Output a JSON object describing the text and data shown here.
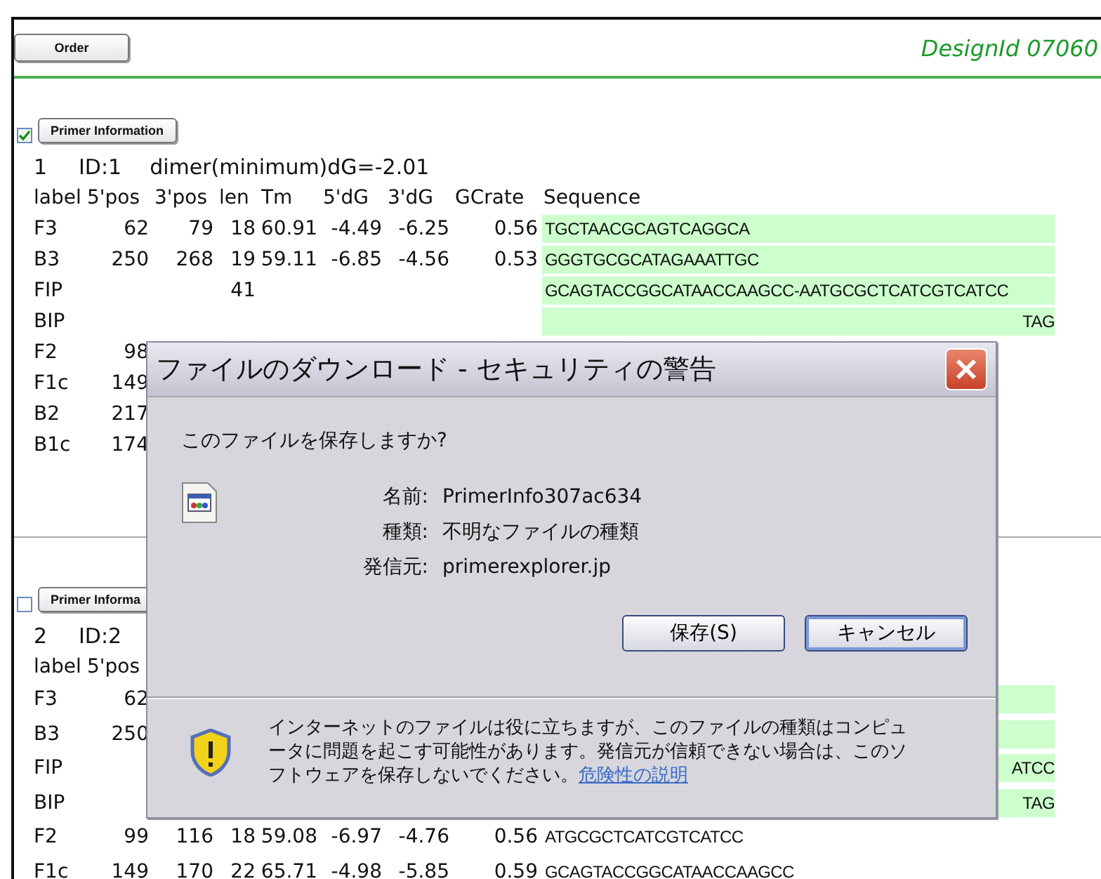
{
  "toolbar": {
    "order_button": "Order",
    "design_id": "DesignId 07060"
  },
  "blocks": [
    {
      "checked": true,
      "button": "Primer Information",
      "number": "1",
      "id": "ID:1",
      "dimer": "dimer(minimum)dG=-2.01",
      "columns": [
        "label",
        "5'pos",
        "3'pos",
        "len",
        "Tm",
        "5'dG",
        "3'dG",
        "GCrate",
        "Sequence"
      ],
      "rows": [
        {
          "label": "F3",
          "pos5": "62",
          "pos3": "79",
          "len": "18",
          "tm": "60.91",
          "dg5": "-4.49",
          "dg3": "-6.25",
          "gc": "0.56",
          "sequence": "TGCTAACGCAGTCAGGCA",
          "highlighted": true
        },
        {
          "label": "B3",
          "pos5": "250",
          "pos3": "268",
          "len": "19",
          "tm": "59.11",
          "dg5": "-6.85",
          "dg3": "-4.56",
          "gc": "0.53",
          "sequence": "GGGTGCGCATAGAAATTGC",
          "highlighted": true
        },
        {
          "label": "FIP",
          "len": "41",
          "sequence": "GCAGTACCGGCATAACCAAGCC-AATGCGCTCATCGTCATCC",
          "highlighted": true
        },
        {
          "label": "BIP",
          "sequence": "TAG",
          "highlighted": true,
          "tail": true
        },
        {
          "label": "F2",
          "pos5": "98"
        },
        {
          "label": "F1c",
          "pos5": "149"
        },
        {
          "label": "B2",
          "pos5": "217"
        },
        {
          "label": "B1c",
          "pos5": "174"
        }
      ]
    },
    {
      "checked": false,
      "button": "Primer Informa",
      "number": "2",
      "id": "ID:2",
      "columns": [
        "label",
        "5'pos"
      ],
      "rows": [
        {
          "label": "F3",
          "pos5": "62",
          "highlighted": true
        },
        {
          "label": "B3",
          "pos5": "250",
          "highlighted": true
        },
        {
          "label": "FIP",
          "sequence": "ATCC",
          "highlighted": true,
          "tail": true
        },
        {
          "label": "BIP",
          "sequence": "TAG",
          "highlighted": true,
          "tail": true
        },
        {
          "label": "F2",
          "pos5": "99",
          "pos3": "116",
          "len": "18",
          "tm": "59.08",
          "dg5": "-6.97",
          "dg3": "-4.76",
          "gc": "0.56",
          "sequence": "ATGCGCTCATCGTCATCC"
        },
        {
          "label": "F1c",
          "pos5": "149",
          "pos3": "170",
          "len": "22",
          "tm": "65.71",
          "dg5": "-4.98",
          "dg3": "-5.85",
          "gc": "0.59",
          "sequence": "GCAGTACCGGCATAACCAAGCC"
        }
      ]
    }
  ],
  "dialog": {
    "title": "ファイルのダウンロード - セキュリティの警告",
    "question": "このファイルを保存しますか?",
    "fields": [
      {
        "label": "名前:",
        "value": "PrimerInfo307ac634"
      },
      {
        "label": "種類:",
        "value": "不明なファイルの種類"
      },
      {
        "label": "発信元:",
        "value": "primerexplorer.jp"
      }
    ],
    "buttons": [
      {
        "label": "保存(S)",
        "focused": false
      },
      {
        "label": "キャンセル",
        "focused": true
      }
    ],
    "warning": {
      "text": "インターネットのファイルは役に立ちますが、このファイルの種類はコンピュータに問題を起こす可能性があります。発信元が信頼できない場合は、このソフトウェアを保存しないでください。",
      "link": "危険性の説明"
    }
  }
}
